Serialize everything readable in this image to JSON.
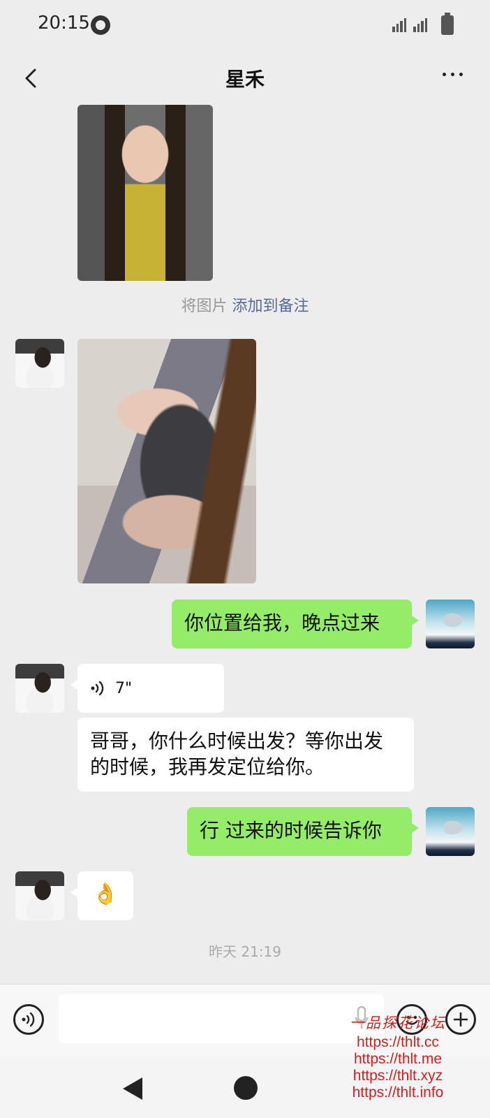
{
  "status_bar": {
    "time": "20:15"
  },
  "header": {
    "title": "星禾"
  },
  "messages": {
    "note_prefix": "将图片",
    "note_link": "添加到备注",
    "out_1": "你位置给我，晚点过来",
    "voice_duration": "7\"",
    "in_text": "哥哥，你什么时候出发？等你出发的时候，我再发定位给你。",
    "out_2": "行 过来的时候告诉你",
    "emoji": "👌",
    "timestamp": "昨天 21:19"
  },
  "watermark": {
    "title": "一品探花论坛",
    "urls": [
      "https://thlt.cc",
      "https://thlt.me",
      "https://thlt.xyz",
      "https://thlt.info"
    ]
  },
  "icons": [
    "back-icon",
    "more-icon",
    "voice-toggle-icon",
    "mic-icon",
    "emoji-icon",
    "plus-icon",
    "nav-back-icon",
    "nav-home-icon"
  ]
}
